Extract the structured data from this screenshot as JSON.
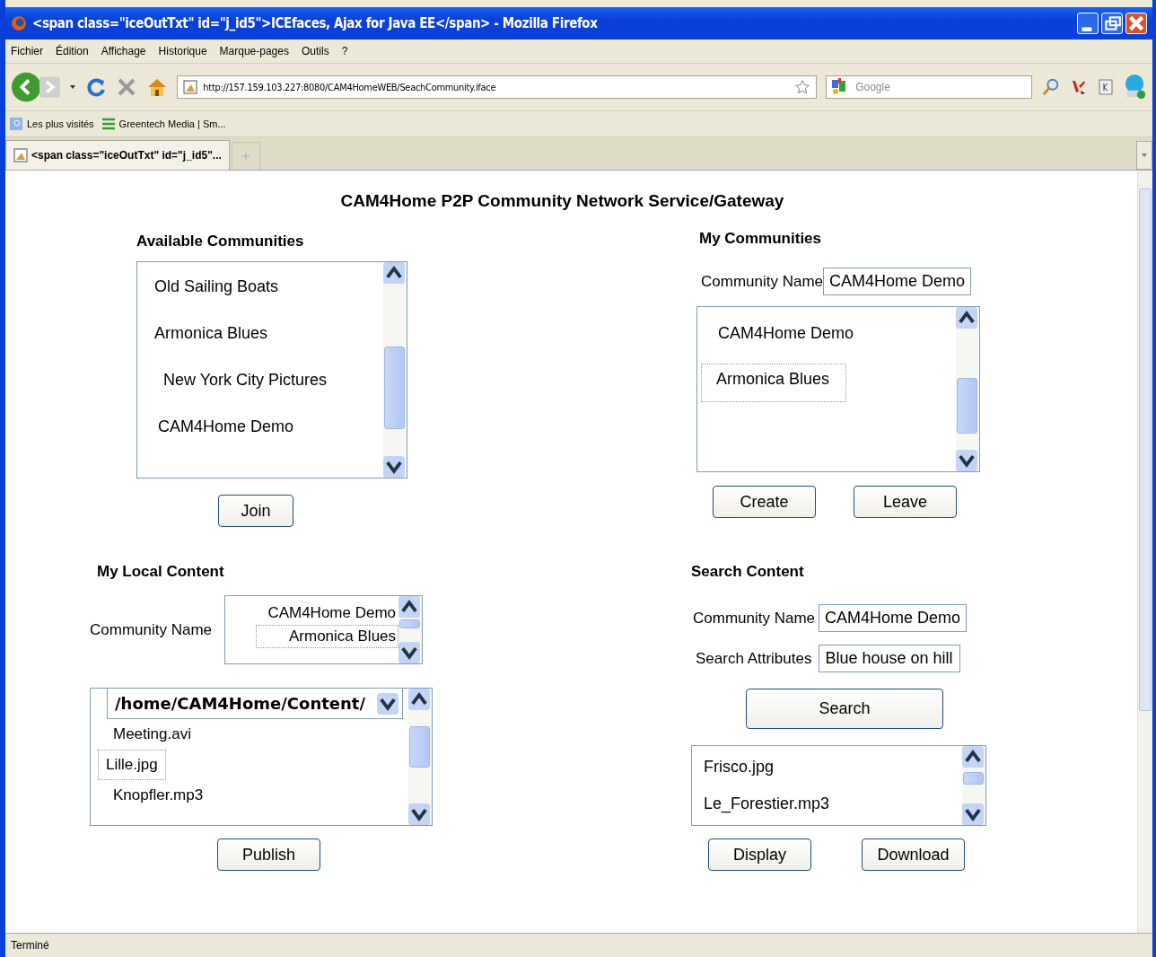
{
  "window": {
    "title": "<span class=\"iceOutTxt\" id=\"j_id5\">ICEfaces, Ajax for Java EE</span> - Mozilla Firefox"
  },
  "menu": [
    "Fichier",
    "Édition",
    "Affichage",
    "Historique",
    "Marque-pages",
    "Outils",
    "?"
  ],
  "toolbar": {
    "url": "http://157.159.103.227:8080/CAM4HomeWEB/SeachCommunity.iface",
    "search_placeholder": "Google"
  },
  "bookmarks": [
    "Les plus visités",
    "Greentech Media | Sm..."
  ],
  "tabs": [
    {
      "label": "<span class=\"iceOutTxt\" id=\"j_id5\"...",
      "selected": true
    }
  ],
  "page": {
    "heading": "CAM4Home P2P Community Network Service/Gateway",
    "available": {
      "title": "Available Communities",
      "items": [
        {
          "label": "Old Sailing Boats",
          "selected": false
        },
        {
          "label": "Armonica Blues",
          "selected": false
        },
        {
          "label": "New York City Pictures",
          "selected": false
        },
        {
          "label": "CAM4Home Demo",
          "selected": false
        }
      ],
      "button": "Join"
    },
    "mine": {
      "title": "My Communities",
      "name_label": "Community Name",
      "name_value": "CAM4Home Demo",
      "items": [
        {
          "label": "CAM4Home Demo",
          "selected": false
        },
        {
          "label": "Armonica Blues",
          "selected": true
        }
      ],
      "buttons": [
        "Create",
        "Leave"
      ]
    },
    "local": {
      "title": "My Local Content",
      "name_label": "Community Name",
      "communities": [
        {
          "label": "CAM4Home Demo",
          "selected": false
        },
        {
          "label": "Armonica Blues",
          "selected": true
        }
      ],
      "folder": "/home/CAM4Home/Content/",
      "files": [
        {
          "label": "Meeting.avi",
          "selected": false
        },
        {
          "label": "Lille.jpg",
          "selected": true
        },
        {
          "label": "Knopfler.mp3",
          "selected": false
        }
      ],
      "button": "Publish"
    },
    "search": {
      "title": "Search Content",
      "name_label": "Community Name",
      "name_value": "CAM4Home Demo",
      "attr_label": "Search Attributes",
      "attr_value": "Blue house on hill",
      "button": "Search",
      "results": [
        {
          "label": "Frisco.jpg",
          "selected": false
        },
        {
          "label": "Le_Forestier.mp3",
          "selected": false
        }
      ],
      "buttons": [
        "Display",
        "Download"
      ]
    }
  },
  "status_bar": "Terminé"
}
